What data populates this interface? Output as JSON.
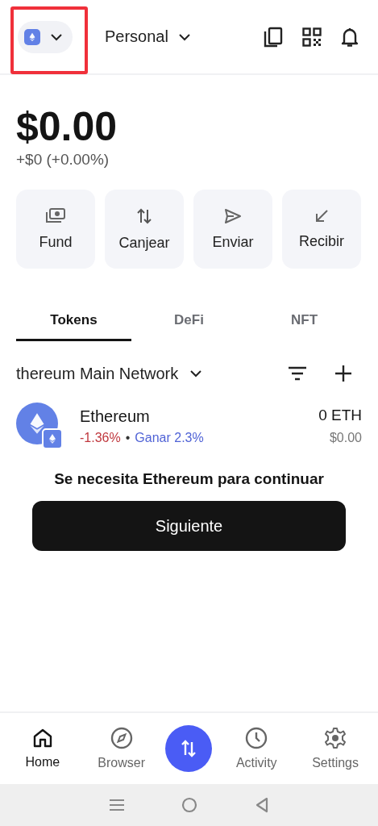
{
  "network_selector": {
    "highlighted": true
  },
  "header": {
    "account": "Personal"
  },
  "balance": {
    "amount": "$0.00",
    "change": "+$0 (+0.00%)"
  },
  "actions": [
    {
      "label": "Fund",
      "kind": "fund"
    },
    {
      "label": "Canjear",
      "kind": "swap"
    },
    {
      "label": "Enviar",
      "kind": "send"
    },
    {
      "label": "Recibir",
      "kind": "receive"
    }
  ],
  "tabs": [
    {
      "label": "Tokens",
      "selected": true
    },
    {
      "label": "DeFi",
      "selected": false
    },
    {
      "label": "NFT",
      "selected": false
    }
  ],
  "network": {
    "name": "thereum Main Network"
  },
  "tokens": [
    {
      "name": "Ethereum",
      "change": "-1.36%",
      "separator": "•",
      "earn": "Ganar 2.3%",
      "amount": "0 ETH",
      "value": "$0.00"
    }
  ],
  "prompt": "Se necesita Ethereum para continuar",
  "primary_button": "Siguiente",
  "nav": [
    {
      "label": "Home",
      "kind": "home",
      "selected": true
    },
    {
      "label": "Browser",
      "kind": "browser",
      "selected": false
    },
    {
      "kind": "swap"
    },
    {
      "label": "Activity",
      "kind": "activity",
      "selected": false
    },
    {
      "label": "Settings",
      "kind": "settings",
      "selected": false
    }
  ]
}
